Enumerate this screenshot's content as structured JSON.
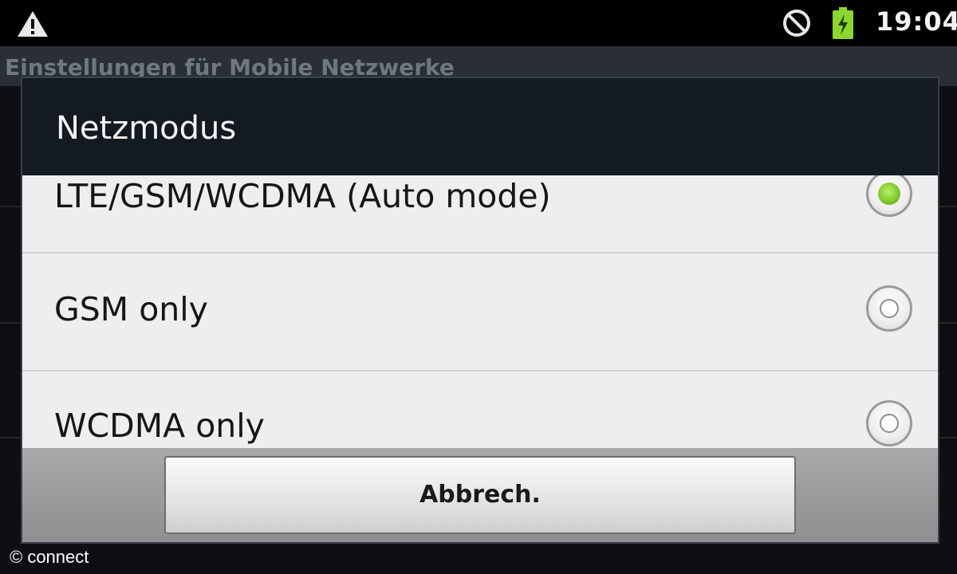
{
  "status_bar": {
    "time": "19:04",
    "icons": [
      "warning-icon",
      "do-not-disturb-icon",
      "battery-charging-icon"
    ]
  },
  "background": {
    "title": "Einstellungen für Mobile Netzwerke"
  },
  "dialog": {
    "title": "Netzmodus",
    "options": [
      {
        "label": "LTE/GSM/WCDMA (Auto mode)",
        "selected": true
      },
      {
        "label": "GSM only",
        "selected": false
      },
      {
        "label": "WCDMA only",
        "selected": false
      }
    ],
    "cancel_label": "Abbrech."
  },
  "colors": {
    "accent": "#7ac62a",
    "battery": "#8cd62f"
  },
  "watermark": "© connect"
}
